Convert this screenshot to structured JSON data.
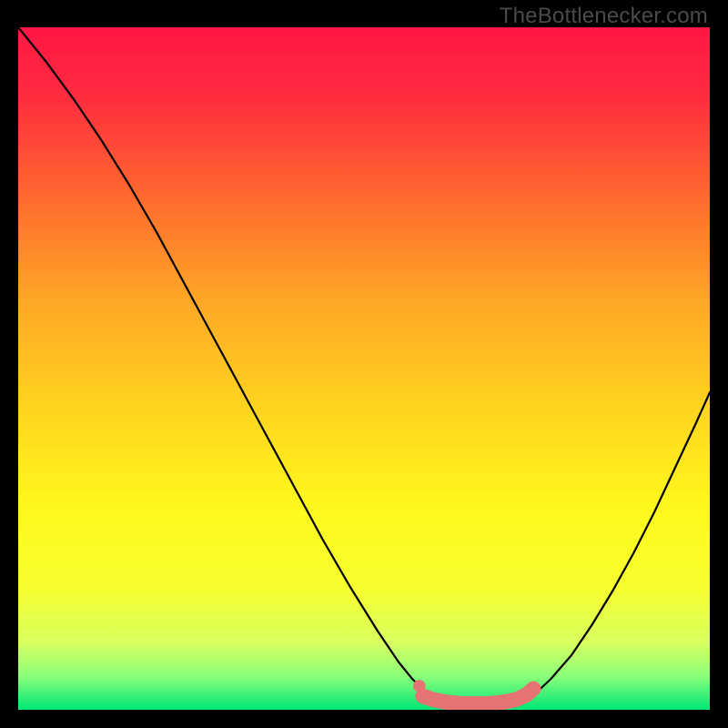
{
  "watermark": "TheBottlenecker.com",
  "chart_data": {
    "type": "line",
    "title": "",
    "xlabel": "",
    "ylabel": "",
    "xlim": [
      0,
      100
    ],
    "ylim": [
      0,
      100
    ],
    "gradient_stops": [
      {
        "offset": 0.0,
        "color": "#ff1744"
      },
      {
        "offset": 0.1,
        "color": "#ff2b3f"
      },
      {
        "offset": 0.25,
        "color": "#ff6a2e"
      },
      {
        "offset": 0.4,
        "color": "#ffa726"
      },
      {
        "offset": 0.55,
        "color": "#ffd21f"
      },
      {
        "offset": 0.7,
        "color": "#fff81c"
      },
      {
        "offset": 0.82,
        "color": "#f7ff2e"
      },
      {
        "offset": 0.9,
        "color": "#d8ff5e"
      },
      {
        "offset": 0.95,
        "color": "#8dff7a"
      },
      {
        "offset": 1.0,
        "color": "#00e676"
      }
    ],
    "series": [
      {
        "name": "bottleneck-curve",
        "points": [
          {
            "x": 0.0,
            "y": 100.0
          },
          {
            "x": 4.0,
            "y": 95.0
          },
          {
            "x": 8.0,
            "y": 89.5
          },
          {
            "x": 12.0,
            "y": 83.5
          },
          {
            "x": 16.0,
            "y": 77.0
          },
          {
            "x": 20.0,
            "y": 70.0
          },
          {
            "x": 24.0,
            "y": 62.5
          },
          {
            "x": 28.0,
            "y": 55.0
          },
          {
            "x": 32.0,
            "y": 47.5
          },
          {
            "x": 36.0,
            "y": 40.0
          },
          {
            "x": 40.0,
            "y": 32.5
          },
          {
            "x": 44.0,
            "y": 25.0
          },
          {
            "x": 48.0,
            "y": 18.0
          },
          {
            "x": 52.0,
            "y": 11.5
          },
          {
            "x": 55.0,
            "y": 7.0
          },
          {
            "x": 57.0,
            "y": 4.5
          },
          {
            "x": 59.0,
            "y": 2.6
          },
          {
            "x": 61.0,
            "y": 1.4
          },
          {
            "x": 63.0,
            "y": 0.7
          },
          {
            "x": 65.0,
            "y": 0.4
          },
          {
            "x": 68.0,
            "y": 0.4
          },
          {
            "x": 71.0,
            "y": 0.7
          },
          {
            "x": 73.0,
            "y": 1.4
          },
          {
            "x": 75.0,
            "y": 2.6
          },
          {
            "x": 77.0,
            "y": 4.5
          },
          {
            "x": 80.0,
            "y": 8.0
          },
          {
            "x": 83.0,
            "y": 12.5
          },
          {
            "x": 86.0,
            "y": 17.5
          },
          {
            "x": 89.0,
            "y": 23.0
          },
          {
            "x": 92.0,
            "y": 29.0
          },
          {
            "x": 95.0,
            "y": 35.5
          },
          {
            "x": 98.0,
            "y": 42.0
          },
          {
            "x": 100.0,
            "y": 46.5
          }
        ]
      }
    ],
    "highlight": {
      "color": "#e57373",
      "dot": {
        "x": 58.0,
        "y": 3.5,
        "r": 1.0
      },
      "band_points": [
        {
          "x": 58.5,
          "y": 2.0
        },
        {
          "x": 60.0,
          "y": 1.5
        },
        {
          "x": 62.0,
          "y": 1.1
        },
        {
          "x": 64.0,
          "y": 0.9
        },
        {
          "x": 66.0,
          "y": 0.9
        },
        {
          "x": 68.0,
          "y": 0.9
        },
        {
          "x": 70.0,
          "y": 1.1
        },
        {
          "x": 72.0,
          "y": 1.5
        },
        {
          "x": 73.5,
          "y": 2.2
        },
        {
          "x": 74.5,
          "y": 3.1
        }
      ],
      "band_width": 2.2
    }
  }
}
